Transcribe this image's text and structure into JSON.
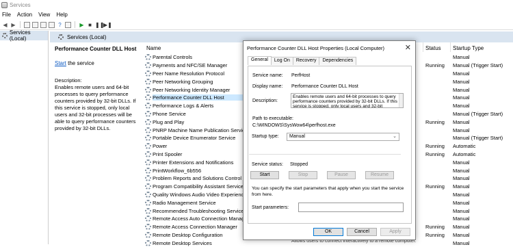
{
  "window": {
    "title": "Services"
  },
  "menu": [
    "File",
    "Action",
    "View",
    "Help"
  ],
  "tree": {
    "root_label": "Services (Local)"
  },
  "main": {
    "header": "Services (Local)"
  },
  "detail": {
    "title": "Performance Counter DLL Host",
    "start_link": "Start",
    "start_suffix": " the service",
    "description_label": "Description:",
    "description": "Enables remote users and 64-bit processes to query performance counters provided by 32-bit DLLs. If this service is stopped, only local users and 32-bit processes will be able to query performance counters provided by 32-bit DLLs."
  },
  "columns": {
    "name": "Name",
    "status": "Status",
    "startup": "Startup Type"
  },
  "services": [
    {
      "name": "Parental Controls",
      "status": "",
      "startup": "Manual"
    },
    {
      "name": "Payments and NFC/SE Manager",
      "status": "Running",
      "startup": "Manual (Trigger Start)"
    },
    {
      "name": "Peer Name Resolution Protocol",
      "status": "",
      "startup": "Manual"
    },
    {
      "name": "Peer Networking Grouping",
      "status": "",
      "startup": "Manual"
    },
    {
      "name": "Peer Networking Identity Manager",
      "status": "",
      "startup": "Manual"
    },
    {
      "name": "Performance Counter DLL Host",
      "status": "",
      "startup": "Manual"
    },
    {
      "name": "Performance Logs & Alerts",
      "status": "",
      "startup": "Manual"
    },
    {
      "name": "Phone Service",
      "status": "",
      "startup": "Manual (Trigger Start)"
    },
    {
      "name": "Plug and Play",
      "status": "Running",
      "startup": "Manual"
    },
    {
      "name": "PNRP Machine Name Publication Service",
      "status": "",
      "startup": "Manual"
    },
    {
      "name": "Portable Device Enumerator Service",
      "status": "",
      "startup": "Manual (Trigger Start)"
    },
    {
      "name": "Power",
      "status": "Running",
      "startup": "Automatic"
    },
    {
      "name": "Print Spooler",
      "status": "Running",
      "startup": "Automatic"
    },
    {
      "name": "Printer Extensions and Notifications",
      "status": "",
      "startup": "Manual"
    },
    {
      "name": "PrintWorkflow_6b556",
      "status": "",
      "startup": "Manual"
    },
    {
      "name": "Problem Reports and Solutions Control Panel Support",
      "status": "",
      "startup": "Manual"
    },
    {
      "name": "Program Compatibility Assistant Service",
      "status": "Running",
      "startup": "Manual"
    },
    {
      "name": "Quality Windows Audio Video Experience",
      "status": "",
      "startup": "Manual"
    },
    {
      "name": "Radio Management Service",
      "status": "",
      "startup": "Manual"
    },
    {
      "name": "Recommended Troubleshooting Service",
      "status": "",
      "startup": "Manual"
    },
    {
      "name": "Remote Access Auto Connection Manager",
      "status": "",
      "startup": "Manual"
    },
    {
      "name": "Remote Access Connection Manager",
      "status": "Running",
      "startup": "Manual"
    },
    {
      "name": "Remote Desktop Configuration",
      "status": "Running",
      "startup": "Manual"
    },
    {
      "name": "Remote Desktop Services",
      "status": "",
      "startup": "Manual"
    }
  ],
  "bottom_peek": "Allows users to connect interactively to a remote computer.",
  "dialog": {
    "title": "Performance Counter DLL Host Properties (Local Computer)",
    "tabs": [
      "General",
      "Log On",
      "Recovery",
      "Dependencies"
    ],
    "service_name_label": "Service name:",
    "service_name": "PerfHost",
    "display_name_label": "Display name:",
    "display_name": "Performance Counter DLL Host",
    "description_label": "Description:",
    "description": "Enables remote users and 64-bit processes to query performance counters provided by 32-bit DLLs. If this service is stopped, only local users and 32-bit",
    "path_label": "Path to executable:",
    "path": "C:\\WINDOWS\\SysWow64\\perfhost.exe",
    "startup_type_label": "Startup type:",
    "startup_type": "Manual",
    "service_status_label": "Service status:",
    "service_status": "Stopped",
    "btn_start": "Start",
    "btn_stop": "Stop",
    "btn_pause": "Pause",
    "btn_resume": "Resume",
    "hint": "You can specify the start parameters that apply when you start the service from here.",
    "start_params_label": "Start parameters:",
    "btn_ok": "OK",
    "btn_cancel": "Cancel",
    "btn_apply": "Apply"
  }
}
